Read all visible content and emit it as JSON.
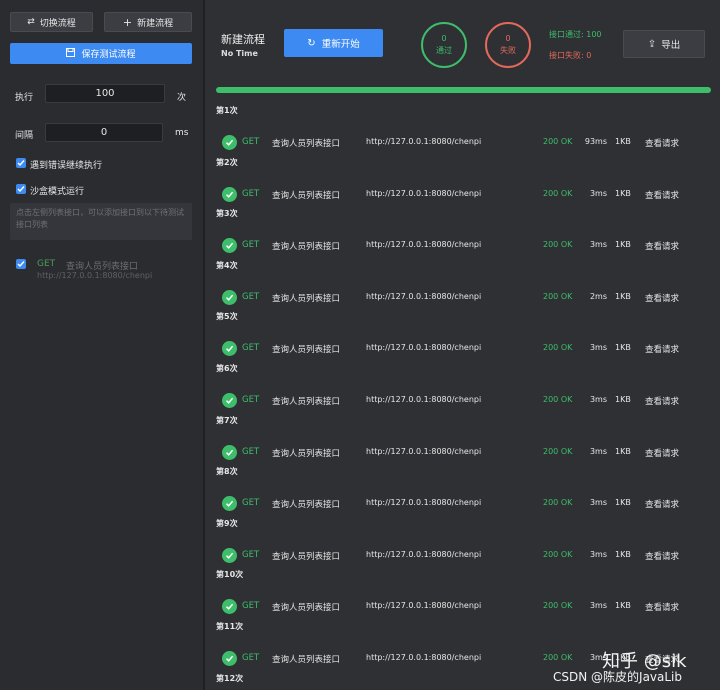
{
  "sidebar": {
    "switch_flow_label": "切换流程",
    "new_flow_label": "新建流程",
    "save_test_flow_label": "保存测试流程",
    "execute_label": "执行",
    "execute_value": "100",
    "execute_unit": "次",
    "interval_label": "间隔",
    "interval_value": "0",
    "interval_unit": "ms",
    "continue_on_error_label": "遇到错误继续执行",
    "sandbox_mode_label": "沙盒模式运行",
    "hint_text": "点击左侧列表接口，可以添加接口到以下待测试接口列表",
    "api_item": {
      "method": "GET",
      "name": "查询人员列表接口",
      "url": "http://127.0.0.1:8080/chenpi"
    }
  },
  "header": {
    "title": "新建流程",
    "subtitle": "No Time",
    "restart_label": "重新开始",
    "pass_count": "0",
    "pass_label": "通过",
    "fail_count": "0",
    "fail_label": "失败",
    "api_pass_text": "接口通过: 100",
    "api_fail_text": "接口失败: 0",
    "export_label": "导出"
  },
  "progress": {
    "fraction": 1.0
  },
  "colors": {
    "accent": "#3d8bf2",
    "success": "#3ebd6b",
    "fail": "#e2695b"
  },
  "rounds": [
    {
      "label": "第1次",
      "time": "93ms"
    },
    {
      "label": "第2次",
      "time": "3ms"
    },
    {
      "label": "第3次",
      "time": "3ms"
    },
    {
      "label": "第4次",
      "time": "2ms"
    },
    {
      "label": "第5次",
      "time": "3ms"
    },
    {
      "label": "第6次",
      "time": "3ms"
    },
    {
      "label": "第7次",
      "time": "3ms"
    },
    {
      "label": "第8次",
      "time": "3ms"
    },
    {
      "label": "第9次",
      "time": "3ms"
    },
    {
      "label": "第10次",
      "time": "3ms"
    },
    {
      "label": "第11次",
      "time": "3ms"
    },
    {
      "label": "第12次",
      "time": ""
    }
  ],
  "result_row": {
    "method": "GET",
    "name": "查询人员列表接口",
    "url": "http://127.0.0.1:8080/chenpi",
    "status": "200 OK",
    "size": "1KB",
    "view_label": "查看请求"
  },
  "watermark": {
    "zhihu": "知乎 @sik",
    "csdn": "CSDN @陈皮的JavaLib"
  }
}
